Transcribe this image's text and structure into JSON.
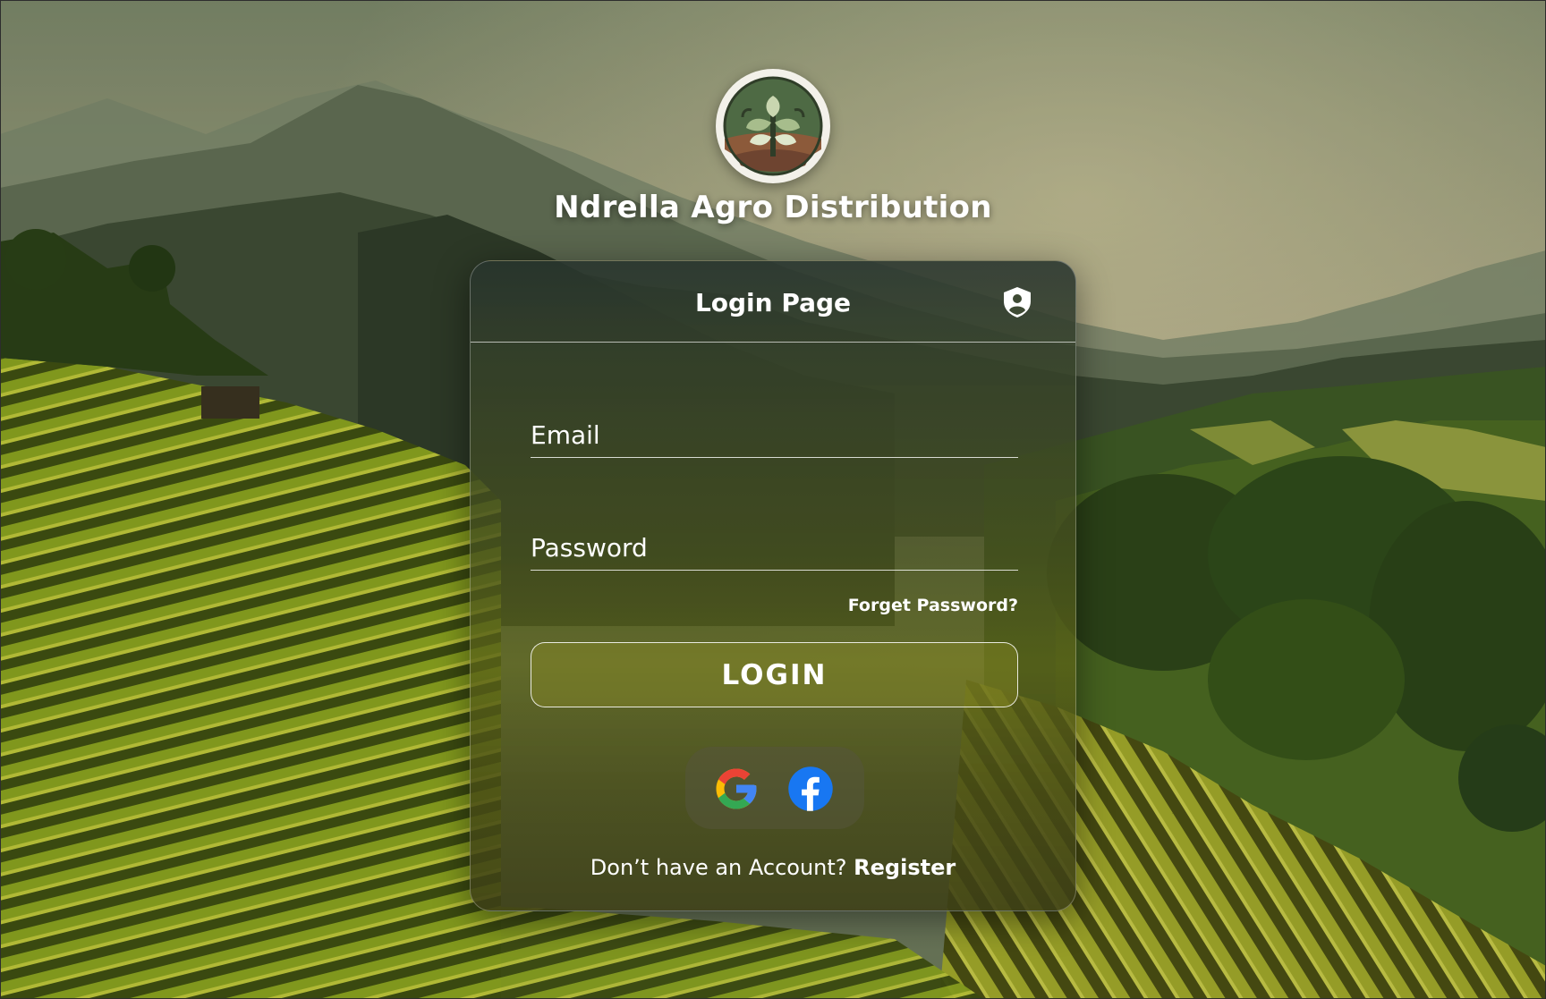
{
  "brand": {
    "name": "Ndrella Agro Distribution",
    "logo_icon": "plant-leaves-logo-icon"
  },
  "login_card": {
    "title": "Login Page",
    "header_icon": "shield-user-icon",
    "email_placeholder": "Email",
    "password_placeholder": "Password",
    "forgot_password": "Forget Password?",
    "login_button": "LOGIN",
    "social_icons": [
      "google-icon",
      "facebook-icon"
    ],
    "register_prompt": "Don’t have an Account? ",
    "register_link": "Register"
  },
  "colors": {
    "text": "#ffffff",
    "card_tint": "#5a6218",
    "google_blue": "#4285F4",
    "google_red": "#EA4335",
    "google_yellow": "#FBBC05",
    "google_green": "#34A853",
    "facebook_blue": "#1877F2"
  }
}
